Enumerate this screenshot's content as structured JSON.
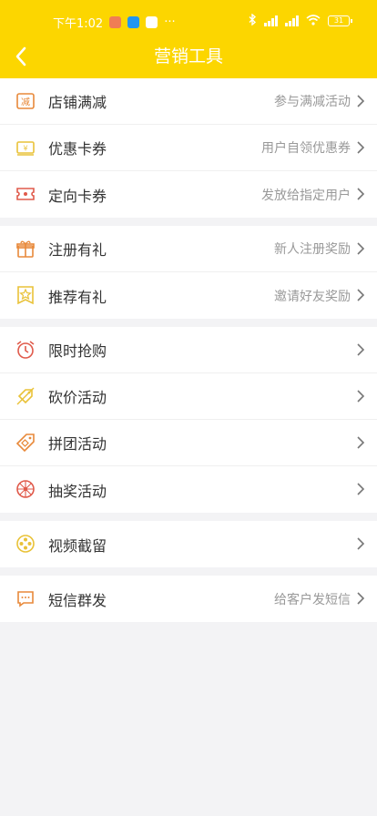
{
  "status_bar": {
    "time": "下午1:02",
    "more": "···",
    "battery": "31"
  },
  "header": {
    "title": "营销工具"
  },
  "groups": [
    {
      "items": [
        {
          "label": "店铺满减",
          "hint": "参与满减活动",
          "icon": "discount-icon"
        },
        {
          "label": "优惠卡券",
          "hint": "用户自领优惠券",
          "icon": "coupon-icon"
        },
        {
          "label": "定向卡券",
          "hint": "发放给指定用户",
          "icon": "ticket-icon"
        }
      ]
    },
    {
      "items": [
        {
          "label": "注册有礼",
          "hint": "新人注册奖励",
          "icon": "gift-icon"
        },
        {
          "label": "推荐有礼",
          "hint": "邀请好友奖励",
          "icon": "star-badge-icon"
        }
      ]
    },
    {
      "items": [
        {
          "label": "限时抢购",
          "hint": "",
          "icon": "alarm-clock-icon"
        },
        {
          "label": "砍价活动",
          "hint": "",
          "icon": "cut-price-icon"
        },
        {
          "label": "拼团活动",
          "hint": "",
          "icon": "price-tag-icon"
        },
        {
          "label": "抽奖活动",
          "hint": "",
          "icon": "lottery-wheel-icon"
        }
      ]
    },
    {
      "items": [
        {
          "label": "视频截留",
          "hint": "",
          "icon": "film-reel-icon"
        }
      ]
    },
    {
      "items": [
        {
          "label": "短信群发",
          "hint": "给客户发短信",
          "icon": "message-icon"
        }
      ]
    }
  ],
  "colors": {
    "header": "#fcd600",
    "background": "#f3f3f5"
  }
}
